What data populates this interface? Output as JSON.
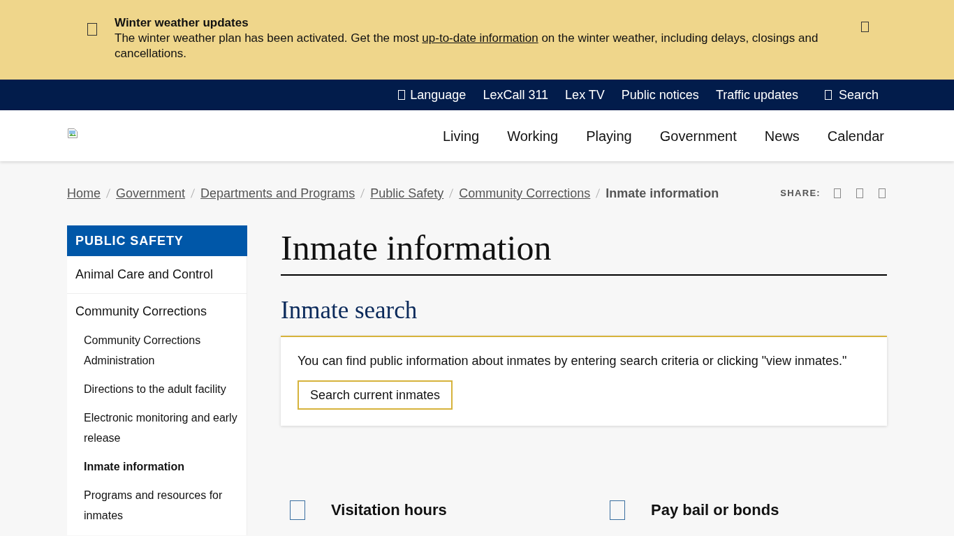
{
  "alert": {
    "title": "Winter weather updates",
    "message_start": "The winter weather plan has been activated. Get the most ",
    "link": "up-to-date information",
    "message_end": " on the winter weather, including delays, closings and cancellations."
  },
  "utility_nav": [
    {
      "label": "Language",
      "kind": "menu"
    },
    {
      "label": "LexCall 311",
      "kind": "link"
    },
    {
      "label": "Lex TV",
      "kind": "link"
    },
    {
      "label": "Public notices",
      "kind": "link"
    },
    {
      "label": "Traffic updates",
      "kind": "link"
    },
    {
      "label": "Search",
      "kind": "search"
    }
  ],
  "main_nav": [
    "Living",
    "Working",
    "Playing",
    "Government",
    "News",
    "Calendar"
  ],
  "breadcrumb": [
    {
      "label": "Home",
      "current": false
    },
    {
      "label": "Government",
      "current": false
    },
    {
      "label": "Departments and Programs",
      "current": false
    },
    {
      "label": "Public Safety",
      "current": false
    },
    {
      "label": "Community Corrections",
      "current": false
    },
    {
      "label": "Inmate information",
      "current": true
    }
  ],
  "share": {
    "label": "SHARE:"
  },
  "sidebar": {
    "title": "PUBLIC SAFETY",
    "items": [
      {
        "label": "Animal Care and Control",
        "selected": false
      },
      {
        "label": "Community Corrections",
        "selected": false,
        "children": [
          {
            "label": "Community Corrections Administration",
            "selected": false
          },
          {
            "label": "Directions to the adult facility",
            "selected": false
          },
          {
            "label": "Electronic monitoring and early release",
            "selected": false
          },
          {
            "label": "Inmate information",
            "selected": true
          },
          {
            "label": "Programs and resources for inmates",
            "selected": false
          }
        ]
      }
    ]
  },
  "main": {
    "title": "Inmate information",
    "section": {
      "heading": "Inmate search",
      "text": "You can find public information about inmates by entering search criteria or clicking \"view inmates.\"",
      "button": "Search current inmates"
    },
    "quick_links": [
      "Visitation hours",
      "Pay bail or bonds"
    ]
  }
}
